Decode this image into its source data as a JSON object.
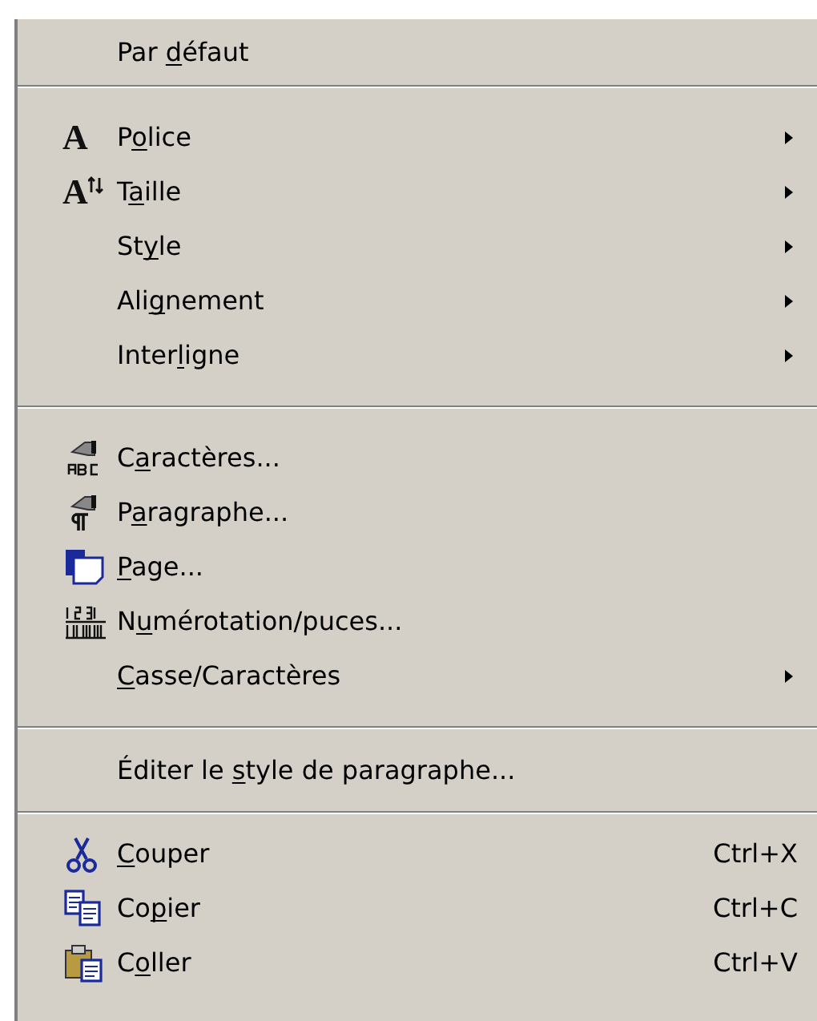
{
  "menu": {
    "groups": [
      {
        "items": [
          {
            "label": [
              {
                "text": "Par ",
                "underlined": false
              },
              {
                "text": "d",
                "underlined": true
              },
              {
                "text": "éfaut",
                "underlined": false
              }
            ],
            "submenu": false
          }
        ]
      },
      {
        "items": [
          {
            "icon_glyph": "A",
            "label": [
              {
                "text": "P",
                "underlined": false
              },
              {
                "text": "o",
                "underlined": true
              },
              {
                "text": "lice",
                "underlined": false
              }
            ],
            "submenu": true
          },
          {
            "icon_glyph": "A",
            "label": [
              {
                "text": "T",
                "underlined": false
              },
              {
                "text": "a",
                "underlined": true
              },
              {
                "text": "ille",
                "underlined": false
              }
            ],
            "submenu": true
          },
          {
            "label": [
              {
                "text": "St",
                "underlined": false
              },
              {
                "text": "y",
                "underlined": true
              },
              {
                "text": "le",
                "underlined": false
              }
            ],
            "submenu": true
          },
          {
            "label": [
              {
                "text": "Ali",
                "underlined": false
              },
              {
                "text": "g",
                "underlined": true
              },
              {
                "text": "nement",
                "underlined": false
              }
            ],
            "submenu": true
          },
          {
            "label": [
              {
                "text": "Inter",
                "underlined": false
              },
              {
                "text": "l",
                "underlined": true
              },
              {
                "text": "igne",
                "underlined": false
              }
            ],
            "submenu": true
          }
        ]
      },
      {
        "items": [
          {
            "label": [
              {
                "text": "C",
                "underlined": false
              },
              {
                "text": "a",
                "underlined": true
              },
              {
                "text": "ractères...",
                "underlined": false
              }
            ],
            "submenu": false
          },
          {
            "label": [
              {
                "text": "P",
                "underlined": false
              },
              {
                "text": "a",
                "underlined": true
              },
              {
                "text": "ragraphe...",
                "underlined": false
              }
            ],
            "submenu": false
          },
          {
            "label": [
              {
                "text": "P",
                "underlined": true
              },
              {
                "text": "age...",
                "underlined": false
              }
            ],
            "submenu": false
          },
          {
            "label": [
              {
                "text": "N",
                "underlined": false
              },
              {
                "text": "u",
                "underlined": true
              },
              {
                "text": "mérotation/puces...",
                "underlined": false
              }
            ],
            "submenu": false
          },
          {
            "label": [
              {
                "text": "C",
                "underlined": true
              },
              {
                "text": "asse/Caractères",
                "underlined": false
              }
            ],
            "submenu": true
          }
        ]
      },
      {
        "items": [
          {
            "label": [
              {
                "text": "Éditer le ",
                "underlined": false
              },
              {
                "text": "s",
                "underlined": true
              },
              {
                "text": "tyle de paragraphe...",
                "underlined": false
              }
            ],
            "submenu": false
          }
        ]
      },
      {
        "items": [
          {
            "label": [
              {
                "text": "C",
                "underlined": true
              },
              {
                "text": "ouper",
                "underlined": false
              }
            ],
            "submenu": false,
            "shortcut": "Ctrl+X"
          },
          {
            "label": [
              {
                "text": "Co",
                "underlined": false
              },
              {
                "text": "p",
                "underlined": true
              },
              {
                "text": "ier",
                "underlined": false
              }
            ],
            "submenu": false,
            "shortcut": "Ctrl+C"
          },
          {
            "label": [
              {
                "text": "C",
                "underlined": false
              },
              {
                "text": "o",
                "underlined": true
              },
              {
                "text": "ller",
                "underlined": false
              }
            ],
            "submenu": false,
            "shortcut": "Ctrl+V"
          }
        ]
      }
    ]
  }
}
